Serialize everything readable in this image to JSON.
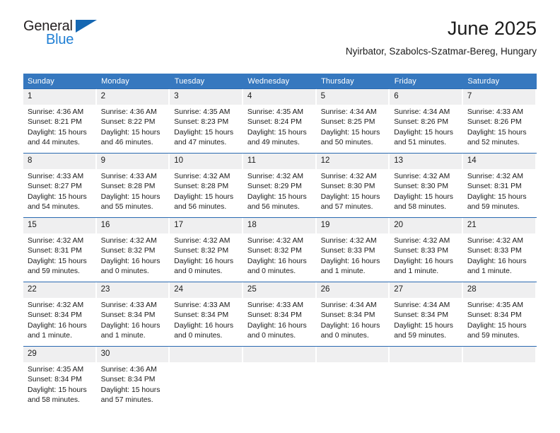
{
  "brand": {
    "line1": "General",
    "line2": "Blue",
    "triangle_color": "#1567b2",
    "blue_text_color": "#1f7fd4"
  },
  "header": {
    "title": "June 2025",
    "location": "Nyirbator, Szabolcs-Szatmar-Bereg, Hungary"
  },
  "colors": {
    "header_row_bg": "#3678bf",
    "row_divider": "#2a6ab1",
    "daynum_bg": "#efeff0",
    "text": "#1a1a1a"
  },
  "weekdays": [
    "Sunday",
    "Monday",
    "Tuesday",
    "Wednesday",
    "Thursday",
    "Friday",
    "Saturday"
  ],
  "weeks": [
    [
      {
        "day": "1",
        "sunrise": "Sunrise: 4:36 AM",
        "sunset": "Sunset: 8:21 PM",
        "daylight1": "Daylight: 15 hours",
        "daylight2": "and 44 minutes."
      },
      {
        "day": "2",
        "sunrise": "Sunrise: 4:36 AM",
        "sunset": "Sunset: 8:22 PM",
        "daylight1": "Daylight: 15 hours",
        "daylight2": "and 46 minutes."
      },
      {
        "day": "3",
        "sunrise": "Sunrise: 4:35 AM",
        "sunset": "Sunset: 8:23 PM",
        "daylight1": "Daylight: 15 hours",
        "daylight2": "and 47 minutes."
      },
      {
        "day": "4",
        "sunrise": "Sunrise: 4:35 AM",
        "sunset": "Sunset: 8:24 PM",
        "daylight1": "Daylight: 15 hours",
        "daylight2": "and 49 minutes."
      },
      {
        "day": "5",
        "sunrise": "Sunrise: 4:34 AM",
        "sunset": "Sunset: 8:25 PM",
        "daylight1": "Daylight: 15 hours",
        "daylight2": "and 50 minutes."
      },
      {
        "day": "6",
        "sunrise": "Sunrise: 4:34 AM",
        "sunset": "Sunset: 8:26 PM",
        "daylight1": "Daylight: 15 hours",
        "daylight2": "and 51 minutes."
      },
      {
        "day": "7",
        "sunrise": "Sunrise: 4:33 AM",
        "sunset": "Sunset: 8:26 PM",
        "daylight1": "Daylight: 15 hours",
        "daylight2": "and 52 minutes."
      }
    ],
    [
      {
        "day": "8",
        "sunrise": "Sunrise: 4:33 AM",
        "sunset": "Sunset: 8:27 PM",
        "daylight1": "Daylight: 15 hours",
        "daylight2": "and 54 minutes."
      },
      {
        "day": "9",
        "sunrise": "Sunrise: 4:33 AM",
        "sunset": "Sunset: 8:28 PM",
        "daylight1": "Daylight: 15 hours",
        "daylight2": "and 55 minutes."
      },
      {
        "day": "10",
        "sunrise": "Sunrise: 4:32 AM",
        "sunset": "Sunset: 8:28 PM",
        "daylight1": "Daylight: 15 hours",
        "daylight2": "and 56 minutes."
      },
      {
        "day": "11",
        "sunrise": "Sunrise: 4:32 AM",
        "sunset": "Sunset: 8:29 PM",
        "daylight1": "Daylight: 15 hours",
        "daylight2": "and 56 minutes."
      },
      {
        "day": "12",
        "sunrise": "Sunrise: 4:32 AM",
        "sunset": "Sunset: 8:30 PM",
        "daylight1": "Daylight: 15 hours",
        "daylight2": "and 57 minutes."
      },
      {
        "day": "13",
        "sunrise": "Sunrise: 4:32 AM",
        "sunset": "Sunset: 8:30 PM",
        "daylight1": "Daylight: 15 hours",
        "daylight2": "and 58 minutes."
      },
      {
        "day": "14",
        "sunrise": "Sunrise: 4:32 AM",
        "sunset": "Sunset: 8:31 PM",
        "daylight1": "Daylight: 15 hours",
        "daylight2": "and 59 minutes."
      }
    ],
    [
      {
        "day": "15",
        "sunrise": "Sunrise: 4:32 AM",
        "sunset": "Sunset: 8:31 PM",
        "daylight1": "Daylight: 15 hours",
        "daylight2": "and 59 minutes."
      },
      {
        "day": "16",
        "sunrise": "Sunrise: 4:32 AM",
        "sunset": "Sunset: 8:32 PM",
        "daylight1": "Daylight: 16 hours",
        "daylight2": "and 0 minutes."
      },
      {
        "day": "17",
        "sunrise": "Sunrise: 4:32 AM",
        "sunset": "Sunset: 8:32 PM",
        "daylight1": "Daylight: 16 hours",
        "daylight2": "and 0 minutes."
      },
      {
        "day": "18",
        "sunrise": "Sunrise: 4:32 AM",
        "sunset": "Sunset: 8:32 PM",
        "daylight1": "Daylight: 16 hours",
        "daylight2": "and 0 minutes."
      },
      {
        "day": "19",
        "sunrise": "Sunrise: 4:32 AM",
        "sunset": "Sunset: 8:33 PM",
        "daylight1": "Daylight: 16 hours",
        "daylight2": "and 1 minute."
      },
      {
        "day": "20",
        "sunrise": "Sunrise: 4:32 AM",
        "sunset": "Sunset: 8:33 PM",
        "daylight1": "Daylight: 16 hours",
        "daylight2": "and 1 minute."
      },
      {
        "day": "21",
        "sunrise": "Sunrise: 4:32 AM",
        "sunset": "Sunset: 8:33 PM",
        "daylight1": "Daylight: 16 hours",
        "daylight2": "and 1 minute."
      }
    ],
    [
      {
        "day": "22",
        "sunrise": "Sunrise: 4:32 AM",
        "sunset": "Sunset: 8:34 PM",
        "daylight1": "Daylight: 16 hours",
        "daylight2": "and 1 minute."
      },
      {
        "day": "23",
        "sunrise": "Sunrise: 4:33 AM",
        "sunset": "Sunset: 8:34 PM",
        "daylight1": "Daylight: 16 hours",
        "daylight2": "and 1 minute."
      },
      {
        "day": "24",
        "sunrise": "Sunrise: 4:33 AM",
        "sunset": "Sunset: 8:34 PM",
        "daylight1": "Daylight: 16 hours",
        "daylight2": "and 0 minutes."
      },
      {
        "day": "25",
        "sunrise": "Sunrise: 4:33 AM",
        "sunset": "Sunset: 8:34 PM",
        "daylight1": "Daylight: 16 hours",
        "daylight2": "and 0 minutes."
      },
      {
        "day": "26",
        "sunrise": "Sunrise: 4:34 AM",
        "sunset": "Sunset: 8:34 PM",
        "daylight1": "Daylight: 16 hours",
        "daylight2": "and 0 minutes."
      },
      {
        "day": "27",
        "sunrise": "Sunrise: 4:34 AM",
        "sunset": "Sunset: 8:34 PM",
        "daylight1": "Daylight: 15 hours",
        "daylight2": "and 59 minutes."
      },
      {
        "day": "28",
        "sunrise": "Sunrise: 4:35 AM",
        "sunset": "Sunset: 8:34 PM",
        "daylight1": "Daylight: 15 hours",
        "daylight2": "and 59 minutes."
      }
    ],
    [
      {
        "day": "29",
        "sunrise": "Sunrise: 4:35 AM",
        "sunset": "Sunset: 8:34 PM",
        "daylight1": "Daylight: 15 hours",
        "daylight2": "and 58 minutes."
      },
      {
        "day": "30",
        "sunrise": "Sunrise: 4:36 AM",
        "sunset": "Sunset: 8:34 PM",
        "daylight1": "Daylight: 15 hours",
        "daylight2": "and 57 minutes."
      },
      {
        "day": "",
        "sunrise": "",
        "sunset": "",
        "daylight1": "",
        "daylight2": ""
      },
      {
        "day": "",
        "sunrise": "",
        "sunset": "",
        "daylight1": "",
        "daylight2": ""
      },
      {
        "day": "",
        "sunrise": "",
        "sunset": "",
        "daylight1": "",
        "daylight2": ""
      },
      {
        "day": "",
        "sunrise": "",
        "sunset": "",
        "daylight1": "",
        "daylight2": ""
      },
      {
        "day": "",
        "sunrise": "",
        "sunset": "",
        "daylight1": "",
        "daylight2": ""
      }
    ]
  ]
}
